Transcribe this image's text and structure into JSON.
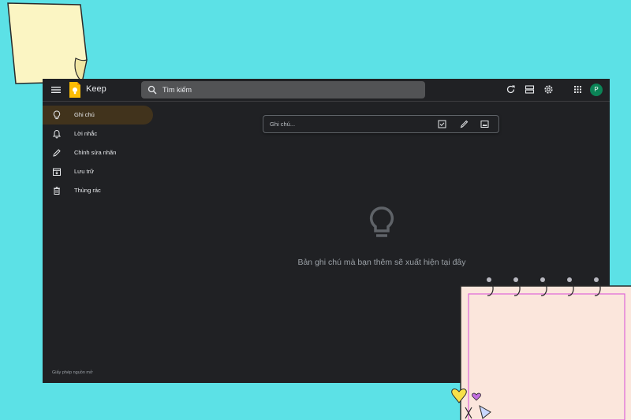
{
  "app": {
    "name": "Keep"
  },
  "search": {
    "placeholder": "Tìm kiếm"
  },
  "toolbar": {
    "icons": [
      "refresh-icon",
      "list-view-icon",
      "settings-icon",
      "apps-grid-icon"
    ],
    "avatar_letter": "P"
  },
  "sidebar": {
    "items": [
      {
        "label": "Ghi chú",
        "icon": "lightbulb-icon",
        "active": true
      },
      {
        "label": "Lời nhắc",
        "icon": "bell-icon",
        "active": false
      },
      {
        "label": "Chỉnh sửa nhãn",
        "icon": "pencil-icon",
        "active": false
      },
      {
        "label": "Lưu trữ",
        "icon": "archive-icon",
        "active": false
      },
      {
        "label": "Thùng rác",
        "icon": "trash-icon",
        "active": false
      }
    ],
    "license": "Giấy phép nguồn mở"
  },
  "composer": {
    "placeholder": "Ghi chú..."
  },
  "empty_state": {
    "message": "Bản ghi chú mà bạn thêm sẽ xuất hiện tại đây"
  },
  "colors": {
    "background": "#5ce1e6",
    "window": "#202124",
    "active_nav": "#41331c",
    "keep_yellow": "#fbbc04",
    "avatar": "#0b8457"
  }
}
